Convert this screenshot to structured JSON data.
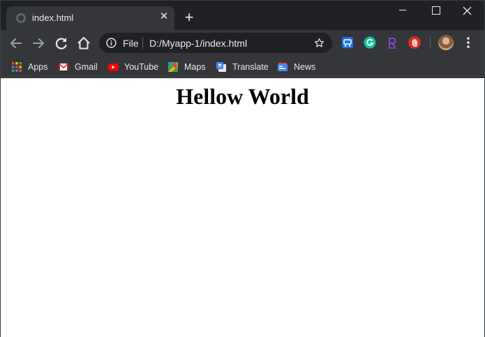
{
  "tab": {
    "title": "index.html",
    "close": "✕"
  },
  "newtab": {
    "label": "+"
  },
  "window": {
    "close": "✕"
  },
  "toolbar": {
    "file_label": "File",
    "url": "D:/Myapp-1/index.html"
  },
  "bookmarks": [
    {
      "label": "Apps",
      "icon": "apps-grid-icon"
    },
    {
      "label": "Gmail",
      "icon": "gmail-icon"
    },
    {
      "label": "YouTube",
      "icon": "youtube-icon"
    },
    {
      "label": "Maps",
      "icon": "maps-icon"
    },
    {
      "label": "Translate",
      "icon": "translate-icon"
    },
    {
      "label": "News",
      "icon": "news-icon"
    }
  ],
  "extensions": [
    {
      "icon": "drive-extension-icon",
      "color": "#1a73e8"
    },
    {
      "icon": "grammarly-icon",
      "color": "#15c39a"
    },
    {
      "icon": "r-extension-icon",
      "color": "#7b4bd6"
    },
    {
      "icon": "adblock-hand-icon",
      "color": "#d93025"
    }
  ],
  "page": {
    "heading": "Hellow World"
  },
  "colors": {
    "frame": "#202124",
    "toolbar": "#35363a",
    "text": "#e8eaed",
    "page_bg": "#ffffff"
  }
}
